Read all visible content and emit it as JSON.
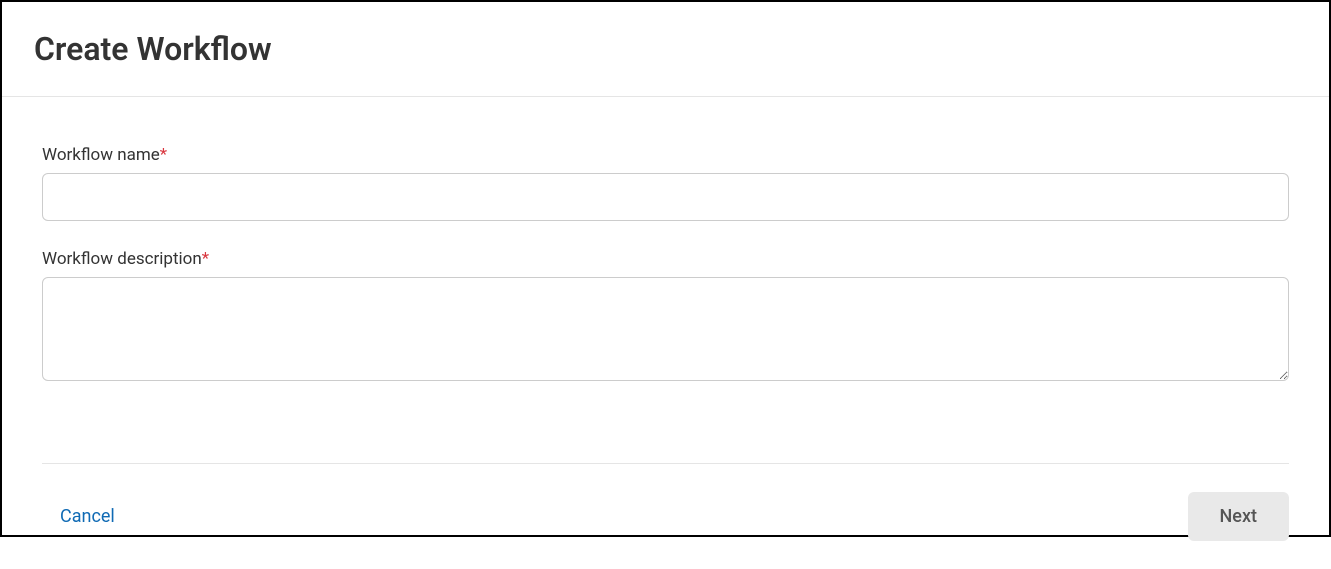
{
  "header": {
    "title": "Create Workflow"
  },
  "form": {
    "name_label": "Workflow name",
    "name_value": "",
    "description_label": "Workflow description",
    "description_value": "",
    "required_marker": "*"
  },
  "footer": {
    "cancel_label": "Cancel",
    "next_label": "Next"
  }
}
